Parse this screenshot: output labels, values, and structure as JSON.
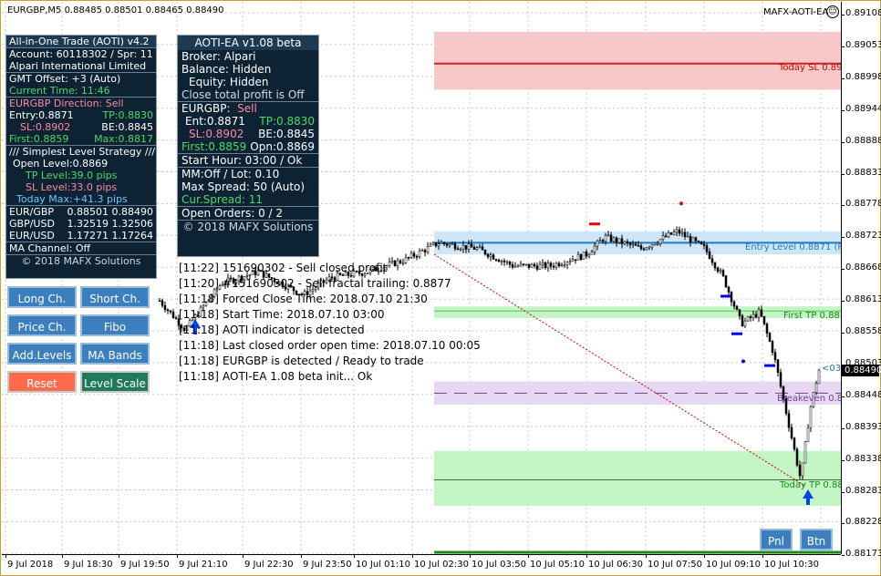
{
  "chart": {
    "title": "EURGBP,M5  0.88485 0.88501 0.88465 0.88490",
    "ea_name": "MAFX-AOTI-EA",
    "ea_face": "☺",
    "current_price": "0.88490",
    "price_labels": [
      "0.89108",
      "0.89053",
      "0.88998",
      "0.88944",
      "0.88888",
      "0.88833",
      "0.88778",
      "0.88723",
      "0.88668",
      "0.88613",
      "0.88558",
      "0.88503",
      "0.88448",
      "0.88393",
      "0.88338",
      "0.88283",
      "0.88228",
      "0.88173"
    ],
    "time_labels": [
      "9 Jul 2018",
      "9 Jul 18:30",
      "9 Jul 19:50",
      "9 Jul 21:10",
      "9 Jul 22:30",
      "9 Jul 23:50",
      "10 Jul 01:10",
      "10 Jul 02:30",
      "10 Jul 03:50",
      "10 Jul 05:10",
      "10 Jul 06:30",
      "10 Jul 07:50",
      "10 Jul 09:10",
      "10 Jul 10:30"
    ],
    "zones": {
      "today_sl": "Today SL 0.89",
      "entry_level": "Entry Level 0.8871 (F",
      "first_tp": "First TP 0.88",
      "breakeven": "Breakeven 0.8",
      "today_tp": "Today TP 0.88",
      "price_tag": "<03"
    },
    "colors": {
      "bull_candle": "#2e8b57",
      "bear_candle": "#cc0000",
      "sl_zone": "#f8c8c8",
      "entry_zone": "#cfe6f8",
      "tp_zone": "#c4f5c4",
      "be_zone": "#e6d8f5"
    }
  },
  "left_panel": {
    "title": "All-in-One Trade (AOTI) v4.2",
    "account": "Account: 60118302 / Spr: 11",
    "broker": "Alpari International Limited",
    "gmt_offset": "GMT Offset: +3 (Auto)",
    "current_time": "Current Time: 11:46",
    "direction": "EURGBP Direction: Sell",
    "entry": "Entry:0.8871",
    "tp": "TP:0.8830",
    "sl": "SL:0.8902",
    "be": "BE:0.8845",
    "first": "First:0.8859",
    "max": "Max:0.8817",
    "strategy": "/// Simplest Level Strategy ///",
    "open_level": "Open Level:0.8869",
    "tp_level": "TP Level:39.0 pips",
    "sl_level": "SL Level:33.0 pips",
    "today_max": "Today Max:+41.3 pips",
    "pairs": [
      {
        "name": "EUR/GBP",
        "bid": "0.88501",
        "ask": "0.88490"
      },
      {
        "name": "GBP/USD",
        "bid": "1.32519",
        "ask": "1.32506"
      },
      {
        "name": "EUR/USD",
        "bid": "1.17271",
        "ask": "1.17264"
      }
    ],
    "ma_channel": "MA Channel: Off",
    "copyright": "© 2018 MAFX Solutions"
  },
  "center_panel": {
    "title": "AOTI-EA v1.08 beta",
    "broker": "Broker: Alpari",
    "balance": "Balance: Hidden",
    "equity": "Equity: Hidden",
    "close_profit": "Close total profit is Off",
    "symbol": "EURGBP:",
    "side": "Sell",
    "ent": "Ent:0.8871",
    "tp": "TP:0.8830",
    "sl": "SL:0.8902",
    "be": "BE:0.8845",
    "first": "First:0.8859",
    "opn": "Opn:0.8869",
    "start_hour": "Start Hour: 03:00 / Ok",
    "mm_lot": "MM:Off  /  Lot: 0.10",
    "max_spread": "Max Spread: 50 (Auto)",
    "cur_spread": "Cur.Spread: 11",
    "open_orders": "Open Orders: 0 / 2",
    "copyright": "© 2018 MAFX Solutions"
  },
  "log": [
    {
      "time": "[11:22]",
      "msg": "151690302 - Sell closed profit"
    },
    {
      "time": "[11:20]",
      "msg": "#151690302 - Sell fractal trailing: 0.8877"
    },
    {
      "time": "[11:18]",
      "msg": "Forced Close Time: 2018.07.10 21:30"
    },
    {
      "time": "[11:18]",
      "msg": "Start Time: 2018.07.10 03:00"
    },
    {
      "time": "[11:18]",
      "msg": "AOTI indicator is detected"
    },
    {
      "time": "[11:18]",
      "msg": "Last closed order open time: 2018.07.10 00:05"
    },
    {
      "time": "[11:18]",
      "msg": "EURGBP is detected / Ready to trade"
    },
    {
      "time": "[11:18]",
      "msg": "AOTI-EA 1.08 beta init... Ok"
    }
  ],
  "buttons": {
    "long_ch": "Long Ch.",
    "short_ch": "Short Ch.",
    "price_ch": "Price Ch.",
    "fibo": "Fibo",
    "add_levels": "Add.Levels",
    "ma_bands": "MA Bands",
    "reset": "Reset",
    "level_scale": "Level Scale",
    "pnl": "Pnl",
    "btn": "Btn"
  }
}
